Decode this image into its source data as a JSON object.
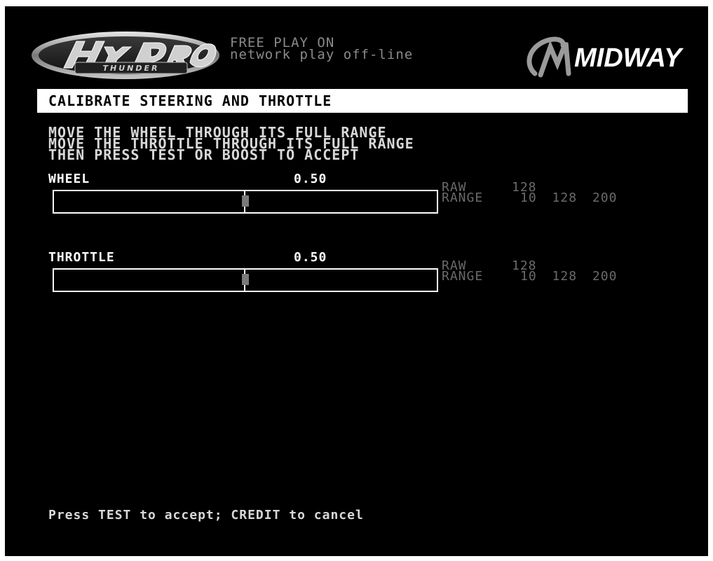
{
  "header": {
    "status_line1": "FREE PLAY ON",
    "status_line2": "network play off-line",
    "left_logo": "hydro-thunder-logo",
    "right_logo": "midway-logo",
    "right_logo_text": "MIDWAY"
  },
  "title": "CALIBRATE STEERING AND THROTTLE",
  "instructions": [
    "MOVE THE WHEEL THROUGH ITS FULL RANGE",
    "MOVE THE THROTTLE THROUGH ITS FULL RANGE",
    "THEN PRESS TEST OR BOOST TO ACCEPT"
  ],
  "wheel": {
    "label": "WHEEL",
    "value": "0.50",
    "position_fraction": 0.5,
    "raw_label": "RAW",
    "raw": "128",
    "range_label": "RANGE",
    "range_min": "10",
    "range_mid": "128",
    "range_max": "200"
  },
  "throttle": {
    "label": "THROTTLE",
    "value": "0.50",
    "position_fraction": 0.5,
    "raw_label": "RAW",
    "raw": "128",
    "range_label": "RANGE",
    "range_min": "10",
    "range_mid": "128",
    "range_max": "200"
  },
  "footer": "Press TEST to accept; CREDIT to cancel",
  "colors": {
    "background": "#000000",
    "title_bar": "#ffffff",
    "marker": "#7a7a7a",
    "dim_text": "#8a8a8a"
  }
}
